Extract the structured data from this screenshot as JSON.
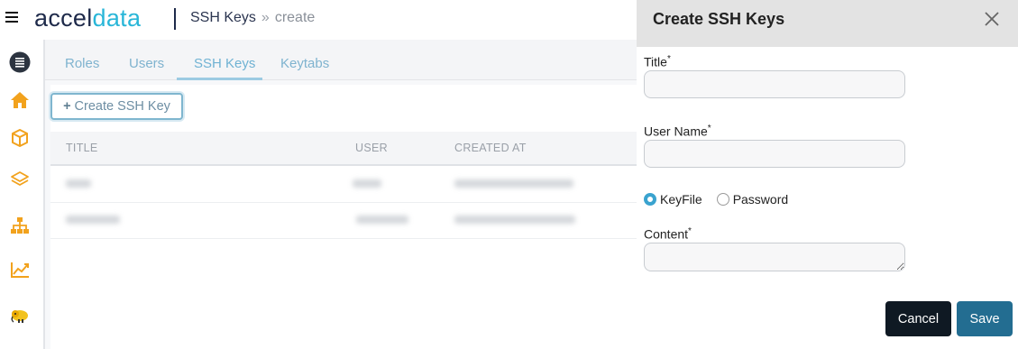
{
  "header": {
    "logo_main": "accel",
    "logo_accent": "data",
    "breadcrumb": [
      "SSH Keys",
      "create"
    ],
    "breadcrumb_separator": "»"
  },
  "sidebar": {
    "icons": [
      "list-icon",
      "home-icon",
      "cube-icon",
      "layers-icon",
      "hierarchy-icon",
      "chart-line-icon",
      "hadoop-elephant-icon"
    ],
    "icon_color": "#f2a21d"
  },
  "tabs": [
    {
      "label": "Roles",
      "active": false
    },
    {
      "label": "Users",
      "active": false
    },
    {
      "label": "SSH Keys",
      "active": true
    },
    {
      "label": "Keytabs",
      "active": false
    }
  ],
  "toolbar": {
    "create_label": "Create SSH Key"
  },
  "table": {
    "columns": [
      "TITLE",
      "USER",
      "CREATED AT"
    ]
  },
  "drawer": {
    "title": "Create SSH Keys",
    "fields": {
      "title_label": "Title",
      "username_label": "User Name",
      "content_label": "Content",
      "required_mark": "*"
    },
    "auth_type": {
      "options": [
        "KeyFile",
        "Password"
      ],
      "selected": "KeyFile"
    },
    "buttons": {
      "cancel": "Cancel",
      "save": "Save"
    },
    "colors": {
      "cancel_bg": "#0f1923",
      "save_bg": "#236d91",
      "header_bg": "#e3e3e3"
    }
  }
}
